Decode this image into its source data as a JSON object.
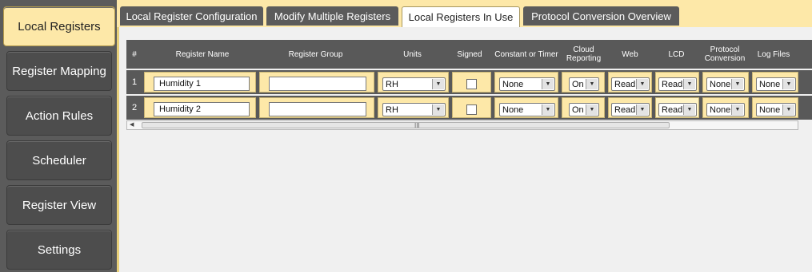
{
  "sidebar": {
    "items": [
      {
        "label": "Local Registers",
        "active": true
      },
      {
        "label": "Register Mapping"
      },
      {
        "label": "Action Rules"
      },
      {
        "label": "Scheduler"
      },
      {
        "label": "Register View"
      },
      {
        "label": "Settings"
      }
    ]
  },
  "tabs": [
    {
      "label": "Local Register Configuration"
    },
    {
      "label": "Modify Multiple Registers"
    },
    {
      "label": "Local Registers In Use",
      "active": true
    },
    {
      "label": "Protocol Conversion Overview"
    }
  ],
  "table": {
    "headers": {
      "num": "#",
      "name": "Register Name",
      "group": "Register Group",
      "units": "Units",
      "signed": "Signed",
      "constant": "Constant or Timer",
      "cloud": "Cloud Reporting",
      "web": "Web",
      "lcd": "LCD",
      "protocol": "Protocol Conversion",
      "logfiles": "Log Files"
    },
    "rows": [
      {
        "num": "1",
        "name": "Humidity 1",
        "group": "",
        "units": "RH",
        "signed": false,
        "constant": "None",
        "cloud": "On",
        "web": "Read",
        "lcd": "Read",
        "protocol": "None",
        "logfiles": "None"
      },
      {
        "num": "2",
        "name": "Humidity 2",
        "group": "",
        "units": "RH",
        "signed": false,
        "constant": "None",
        "cloud": "On",
        "web": "Read",
        "lcd": "Read",
        "protocol": "None",
        "logfiles": "None"
      }
    ]
  },
  "scrollbar": {
    "grip": "III"
  },
  "icons": {
    "dropdown": "chevron-down-icon",
    "scroll_left": "arrow-left-icon"
  }
}
